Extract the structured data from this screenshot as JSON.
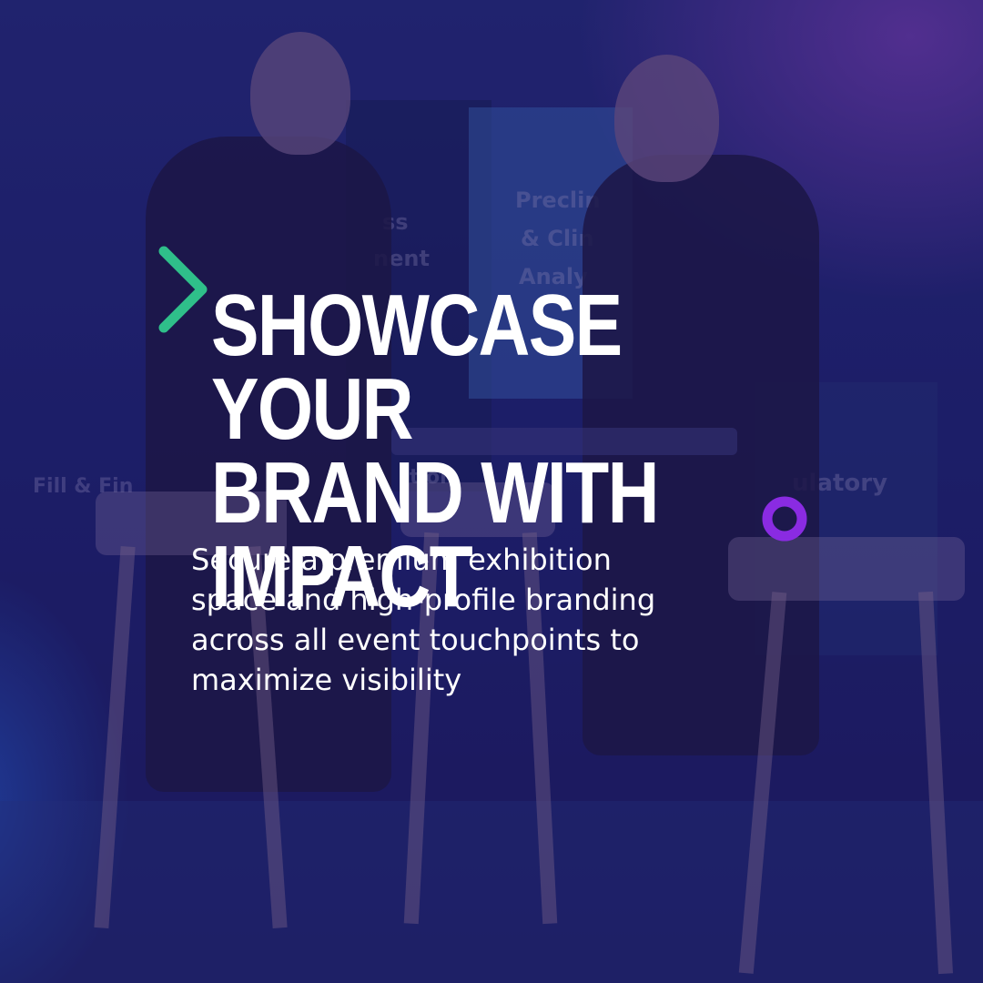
{
  "headline": {
    "line1": "SHOWCASE YOUR",
    "line2": "BRAND WITH IMPACT"
  },
  "body": {
    "lines": [
      "Secure a premium exhibition",
      "space and high-profile branding",
      "across all event touchpoints to",
      "maximize visibility"
    ]
  },
  "backdrop_signage": {
    "panel_center": [
      "Preclin",
      "& Clin",
      "Analy"
    ],
    "panel_left": [
      "ss",
      "nent"
    ],
    "bottom_left": "Fill & Fin",
    "bottom_mid": "tion",
    "bottom_right": "ulatory"
  },
  "decorations": {
    "arrow_icon": "right-arrow-icon",
    "node_icon": "circle-node-icon"
  },
  "colors": {
    "arrow_green": "#2fbf8a",
    "node_purple": "#8a2be2",
    "line_blue": "#5a6fd6",
    "text": "#ffffff"
  }
}
